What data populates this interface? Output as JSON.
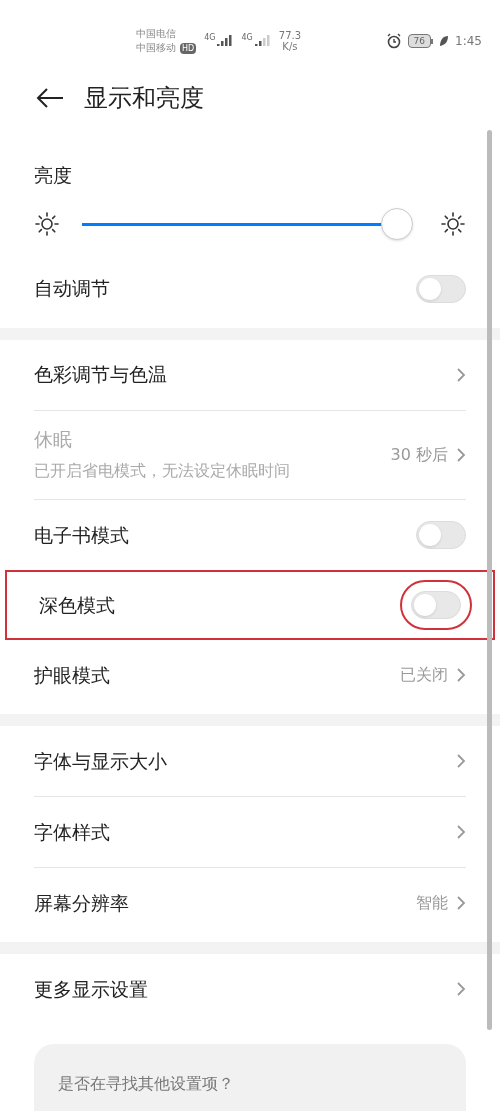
{
  "status_bar": {
    "carriers": [
      "中国电信",
      "中国移动"
    ],
    "hd_badge": "HD",
    "network_types": [
      "4G",
      "4G"
    ],
    "speed_value": "77.3",
    "speed_unit": "K/s",
    "battery": "76",
    "time": "1:45"
  },
  "header": {
    "title": "显示和亮度"
  },
  "brightness": {
    "label": "亮度",
    "level": 0.96
  },
  "sections": [
    [
      {
        "kind": "toggle",
        "label": "自动调节",
        "on": false,
        "highlighted": false
      }
    ],
    [
      {
        "kind": "link",
        "label": "色彩调节与色温",
        "highlighted": false
      },
      {
        "kind": "link",
        "label": "休眠",
        "subtitle": "已开启省电模式，无法设定休眠时间",
        "value": "30 秒后",
        "disabled": true,
        "highlighted": false
      },
      {
        "kind": "toggle",
        "label": "电子书模式",
        "on": false,
        "highlighted": false
      },
      {
        "kind": "toggle",
        "label": "深色模式",
        "on": false,
        "highlighted": true
      },
      {
        "kind": "link",
        "label": "护眼模式",
        "value": "已关闭",
        "highlighted": false
      }
    ],
    [
      {
        "kind": "link",
        "label": "字体与显示大小",
        "highlighted": false
      },
      {
        "kind": "link",
        "label": "字体样式",
        "highlighted": false
      },
      {
        "kind": "link",
        "label": "屏幕分辨率",
        "value": "智能",
        "highlighted": false
      }
    ],
    [
      {
        "kind": "link",
        "label": "更多显示设置",
        "highlighted": false
      }
    ]
  ],
  "suggestion_card": {
    "title": "是否在寻找其他设置项？"
  }
}
